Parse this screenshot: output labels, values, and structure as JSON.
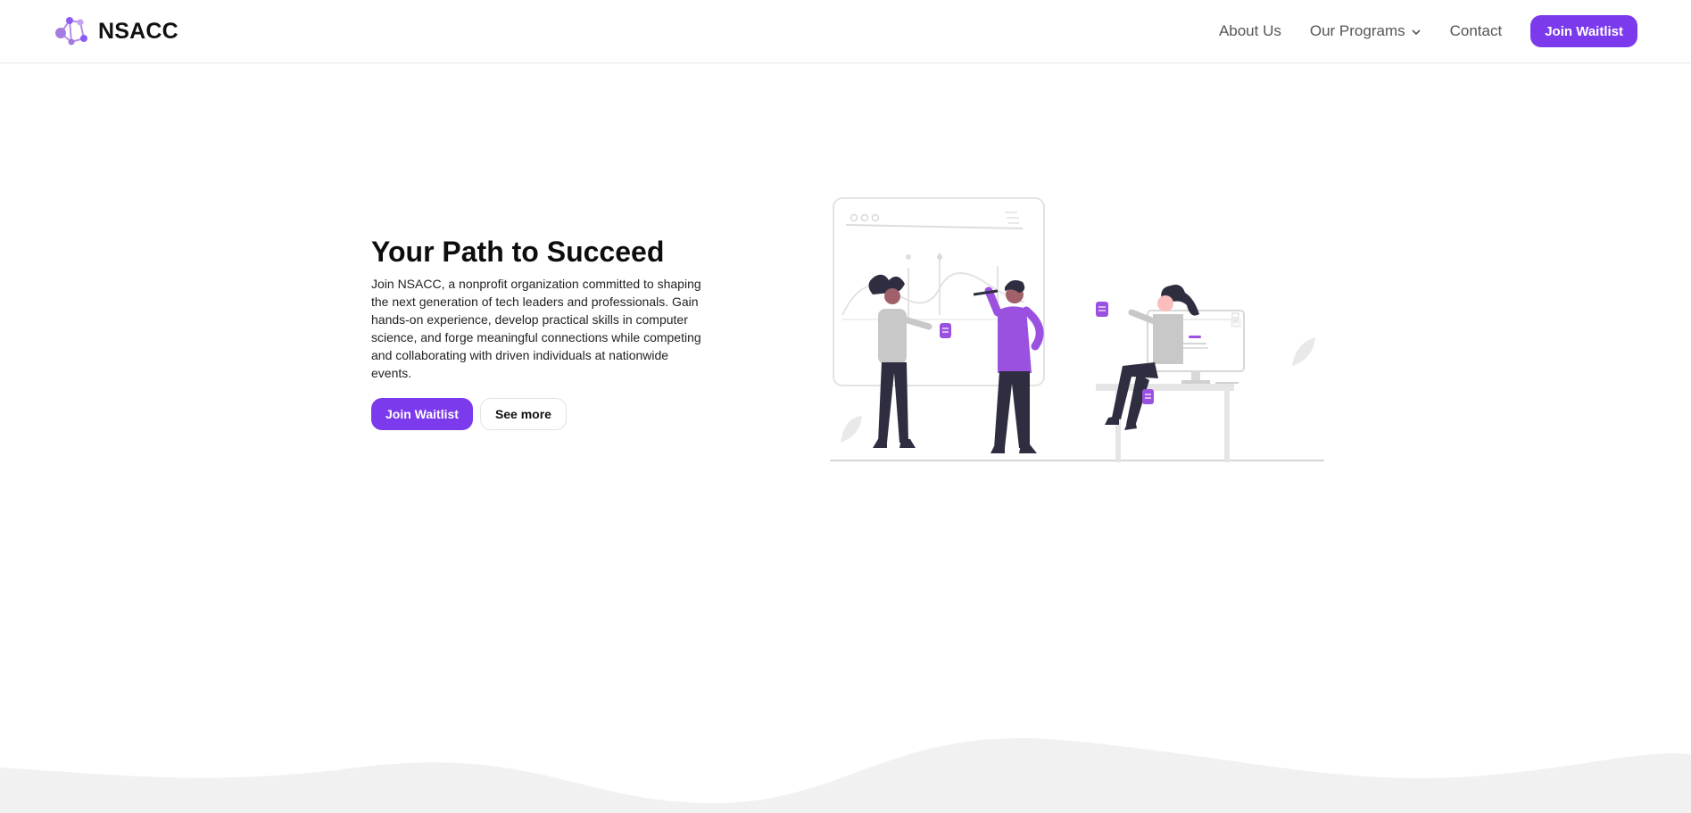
{
  "brand": {
    "name": "NSACC",
    "logo_icon": "network-molecule-icon"
  },
  "nav": {
    "links": [
      {
        "label": "About Us"
      },
      {
        "label": "Our Programs",
        "has_dropdown": true,
        "dropdown_icon": "chevron-down-icon"
      },
      {
        "label": "Contact"
      }
    ],
    "cta_label": "Join Waitlist"
  },
  "hero": {
    "title": "Your Path to Succeed",
    "description": "Join NSACC, a nonprofit organization committed to shaping the next generation of tech leaders and professionals. Gain hands-on experience, develop practical skills in computer science, and forge meaningful connections while competing and collaborating with driven individuals at nationwide events.",
    "primary_button": "Join Waitlist",
    "secondary_button": "See more"
  },
  "theme": {
    "accent": "#7c3aed",
    "illustration_purple": "#9b51e0",
    "wave_gray": "#f1f1f1"
  }
}
